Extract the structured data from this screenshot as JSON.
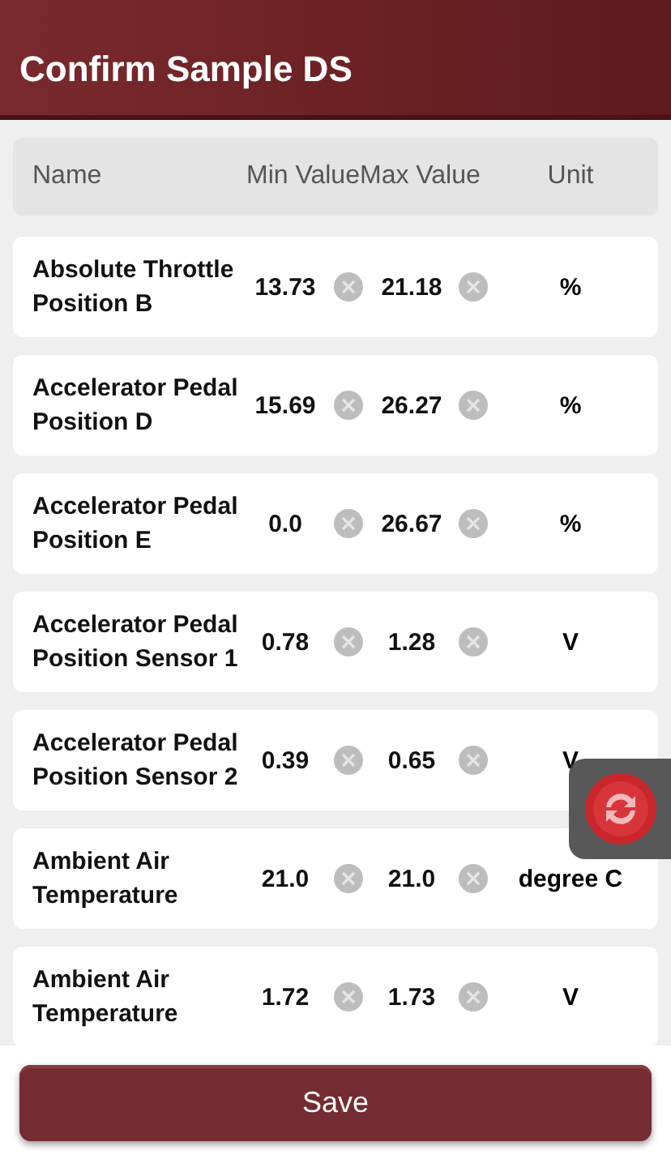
{
  "header": {
    "title": "Confirm Sample DS"
  },
  "table": {
    "columns": [
      "Name",
      "Min Value",
      "Max Value",
      "Unit"
    ],
    "rows": [
      {
        "name": "Absolute Throttle Position B",
        "min": "13.73",
        "max": "21.18",
        "unit": "%"
      },
      {
        "name": "Accelerator Pedal Position D",
        "min": "15.69",
        "max": "26.27",
        "unit": "%"
      },
      {
        "name": "Accelerator Pedal Position E",
        "min": "0.0",
        "max": "26.67",
        "unit": "%"
      },
      {
        "name": "Accelerator Pedal Position Sensor 1",
        "min": "0.78",
        "max": "1.28",
        "unit": "V"
      },
      {
        "name": "Accelerator Pedal Position Sensor 2",
        "min": "0.39",
        "max": "0.65",
        "unit": "V"
      },
      {
        "name": "Ambient Air Temperature",
        "min": "21.0",
        "max": "21.0",
        "unit": "degree C"
      },
      {
        "name": "Ambient Air Temperature",
        "min": "1.72",
        "max": "1.73",
        "unit": "V"
      }
    ]
  },
  "save_button": "Save"
}
